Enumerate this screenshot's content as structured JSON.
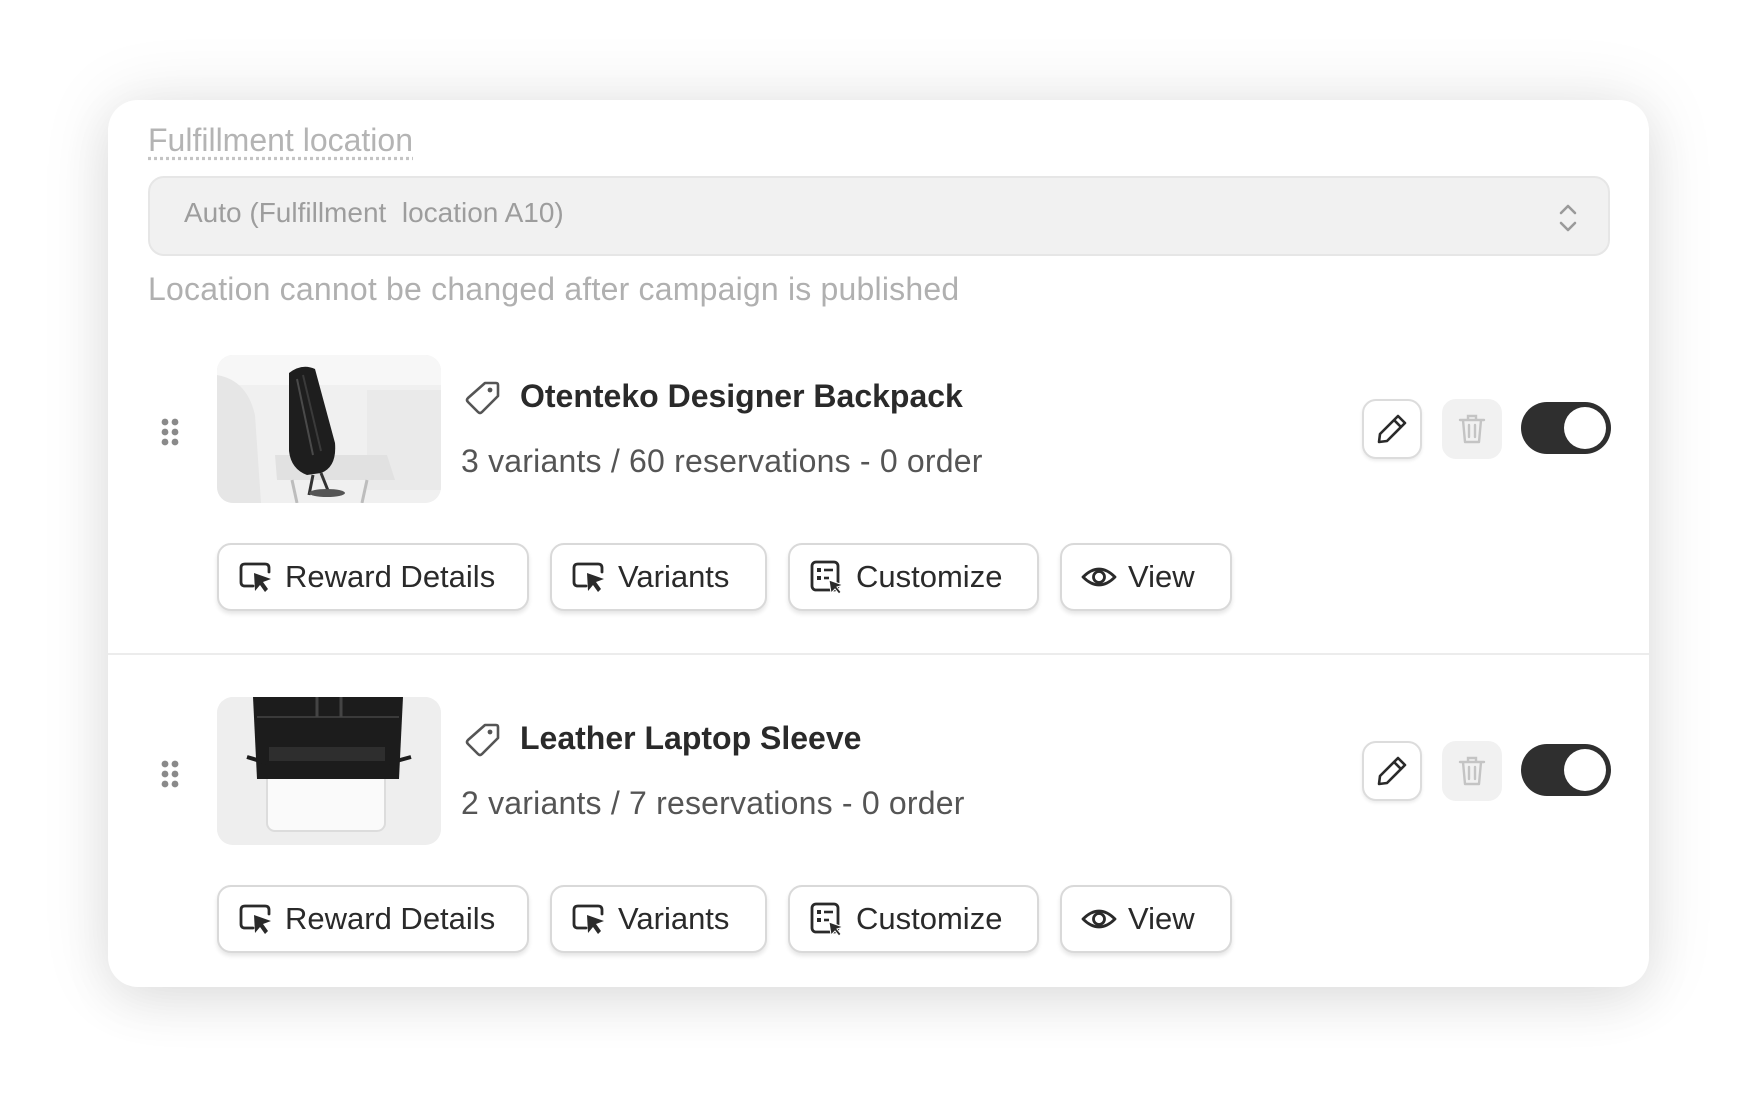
{
  "fulfillment": {
    "label": "Fulfillment location",
    "select_value": "Auto (Fulfillment  location A10)",
    "hint": "Location cannot be changed after campaign is published"
  },
  "items": [
    {
      "title": "Otenteko Designer Backpack",
      "subtitle": "3 variants / 60 reservations - 0 order",
      "enabled": true,
      "actions": {
        "reward_details": "Reward Details",
        "variants": "Variants",
        "customize": "Customize",
        "view": "View"
      }
    },
    {
      "title": "Leather Laptop Sleeve",
      "subtitle": "2 variants / 7 reservations - 0 order",
      "enabled": true,
      "actions": {
        "reward_details": "Reward Details",
        "variants": "Variants",
        "customize": "Customize",
        "view": "View"
      }
    }
  ],
  "colors": {
    "toggle_on": "#2f2f2f",
    "muted_text": "#b0b0b0",
    "title_text": "#2a2a2a"
  }
}
